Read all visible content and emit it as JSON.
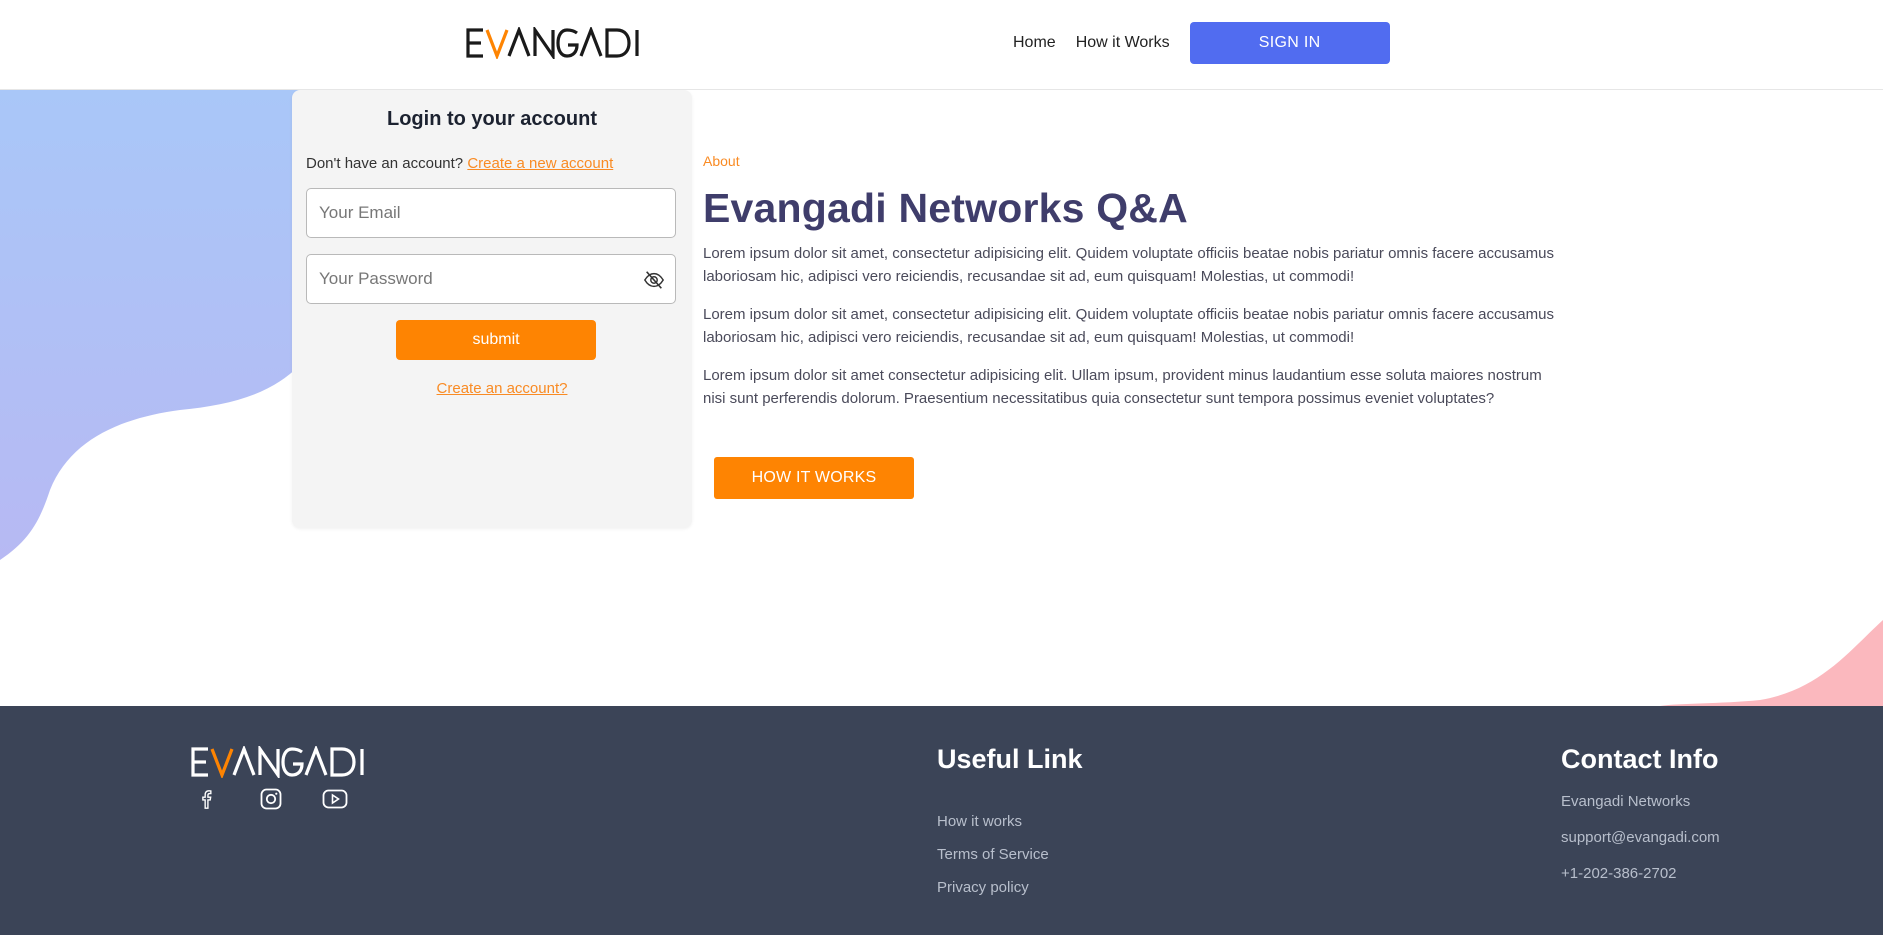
{
  "header": {
    "logo_text": "EVANGADI",
    "nav": {
      "home": "Home",
      "how_it_works": "How it Works"
    },
    "signin_label": "SIGN IN"
  },
  "login": {
    "title": "Login to your account",
    "prompt": "Don't have an account?",
    "create_new_link": "Create a new account",
    "email_placeholder": "Your Email",
    "password_placeholder": "Your Password",
    "submit_label": "submit",
    "create_account_link": "Create an account?"
  },
  "about": {
    "label": "About",
    "title": "Evangadi Networks Q&A",
    "paragraphs": [
      "Lorem ipsum dolor sit amet, consectetur adipisicing elit. Quidem voluptate officiis beatae nobis pariatur omnis facere accusamus laboriosam hic, adipisci vero reiciendis, recusandae sit ad, eum quisquam! Molestias, ut commodi!",
      "Lorem ipsum dolor sit amet, consectetur adipisicing elit. Quidem voluptate officiis beatae nobis pariatur omnis facere accusamus laboriosam hic, adipisci vero reiciendis, recusandae sit ad, eum quisquam! Molestias, ut commodi!",
      "Lorem ipsum dolor sit amet consectetur adipisicing elit. Ullam ipsum, provident minus laudantium esse soluta maiores nostrum nisi sunt perferendis dolorum. Praesentium necessitatibus quia consectetur sunt tempora possimus eveniet voluptates?"
    ],
    "button_label": "HOW IT WORKS"
  },
  "footer": {
    "logo_text": "EVANGADI",
    "socials": [
      "facebook-icon",
      "instagram-icon",
      "youtube-icon"
    ],
    "useful_links": {
      "title": "Useful Link",
      "items": [
        "How it works",
        "Terms of Service",
        "Privacy policy"
      ]
    },
    "contact": {
      "title": "Contact Info",
      "items": [
        "Evangadi Networks",
        "support@evangadi.com",
        "+1-202-386-2702"
      ]
    }
  },
  "colors": {
    "accent_orange": "#fe8402",
    "signin_blue": "#516cf0",
    "footer_bg": "#3b4457",
    "title_purple": "#3f3d6b"
  }
}
